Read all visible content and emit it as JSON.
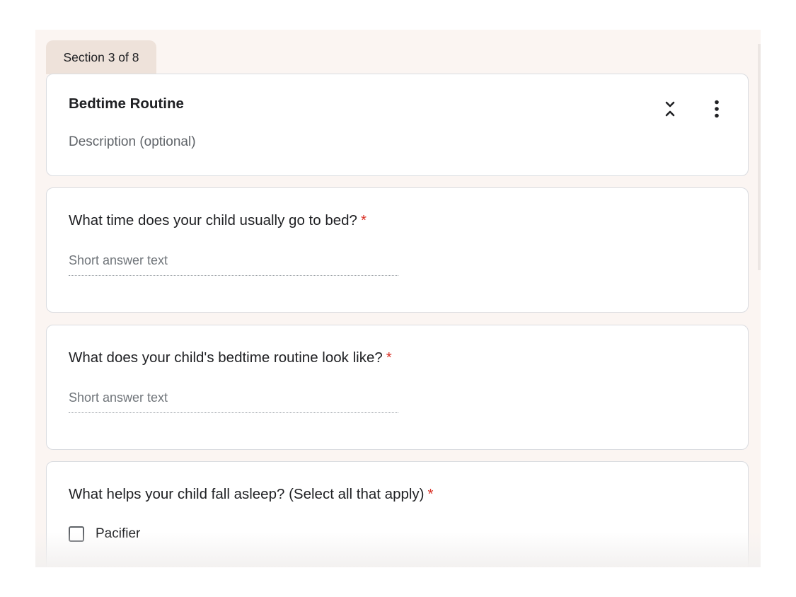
{
  "section_label": "Section 3 of 8",
  "header": {
    "title": "Bedtime Routine",
    "description_placeholder": "Description (optional)",
    "icons": [
      "collapse-icon",
      "more-vert-icon"
    ]
  },
  "questions": [
    {
      "title": "What time does your child usually go to bed?",
      "required_mark": "*",
      "type": "short_answer",
      "placeholder": "Short answer text"
    },
    {
      "title": "What does your child's bedtime routine look like?",
      "required_mark": "*",
      "type": "short_answer",
      "placeholder": "Short answer text"
    },
    {
      "title": "What helps your child fall asleep? (Select all that apply)",
      "required_mark": "*",
      "type": "checkboxes",
      "options": [
        "Pacifier"
      ]
    }
  ],
  "colors": {
    "page_bg": "#fbf5f2",
    "tab_bg": "#eee2da",
    "required": "#d93025"
  }
}
